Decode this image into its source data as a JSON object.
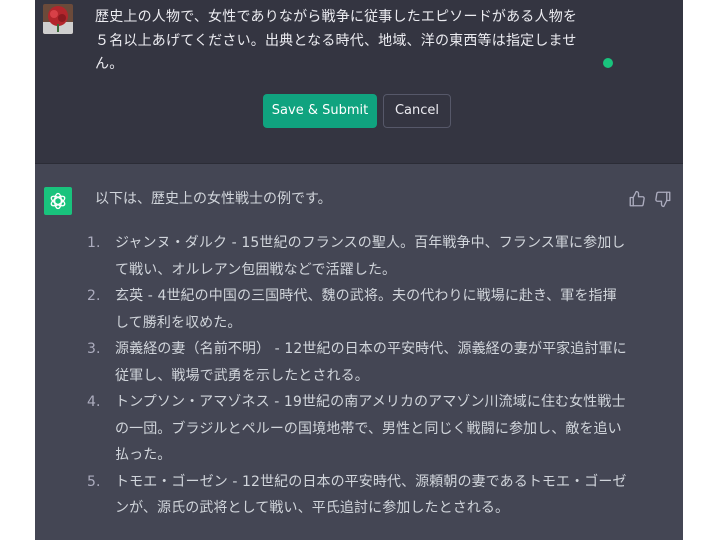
{
  "user_message": {
    "avatar_icon": "user-avatar-photo",
    "text": "歴史上の人物で、女性でありながら戦争に従事したエピソードがある人物を\n５名以上あげてください。出典となる時代、地域、洋の東西等は指定しませ\nん。"
  },
  "edit_controls": {
    "submit_label": "Save & Submit",
    "cancel_label": "Cancel"
  },
  "assistant_message": {
    "avatar_icon": "openai-logo-icon",
    "intro": "以下は、歴史上の女性戦士の例です。",
    "items": [
      {
        "num": "1.",
        "text": "ジャンヌ・ダルク - 15世紀のフランスの聖人。百年戦争中、フランス軍に参加して戦い、オルレアン包囲戦などで活躍した。"
      },
      {
        "num": "2.",
        "text": "玄英 - 4世紀の中国の三国時代、魏の武将。夫の代わりに戦場に赴き、軍を指揮して勝利を収めた。"
      },
      {
        "num": "3.",
        "text": "源義経の妻（名前不明） - 12世紀の日本の平安時代、源義経の妻が平家追討軍に従軍し、戦場で武勇を示したとされる。"
      },
      {
        "num": "4.",
        "text": "トンプソン・アマゾネス - 19世紀の南アメリカのアマゾン川流域に住む女性戦士の一団。ブラジルとペルーの国境地帯で、男性と同じく戦闘に参加し、敵を追い払った。"
      },
      {
        "num": "5.",
        "text": "トモエ・ゴーゼン - 12世紀の日本の平安時代、源頼朝の妻であるトモエ・ゴーゼンが、源氏の武将として戦い、平氏追討に参加したとされる。"
      }
    ]
  },
  "colors": {
    "user_bg": "#343541",
    "assistant_bg": "#444654",
    "accent": "#10a37f"
  }
}
